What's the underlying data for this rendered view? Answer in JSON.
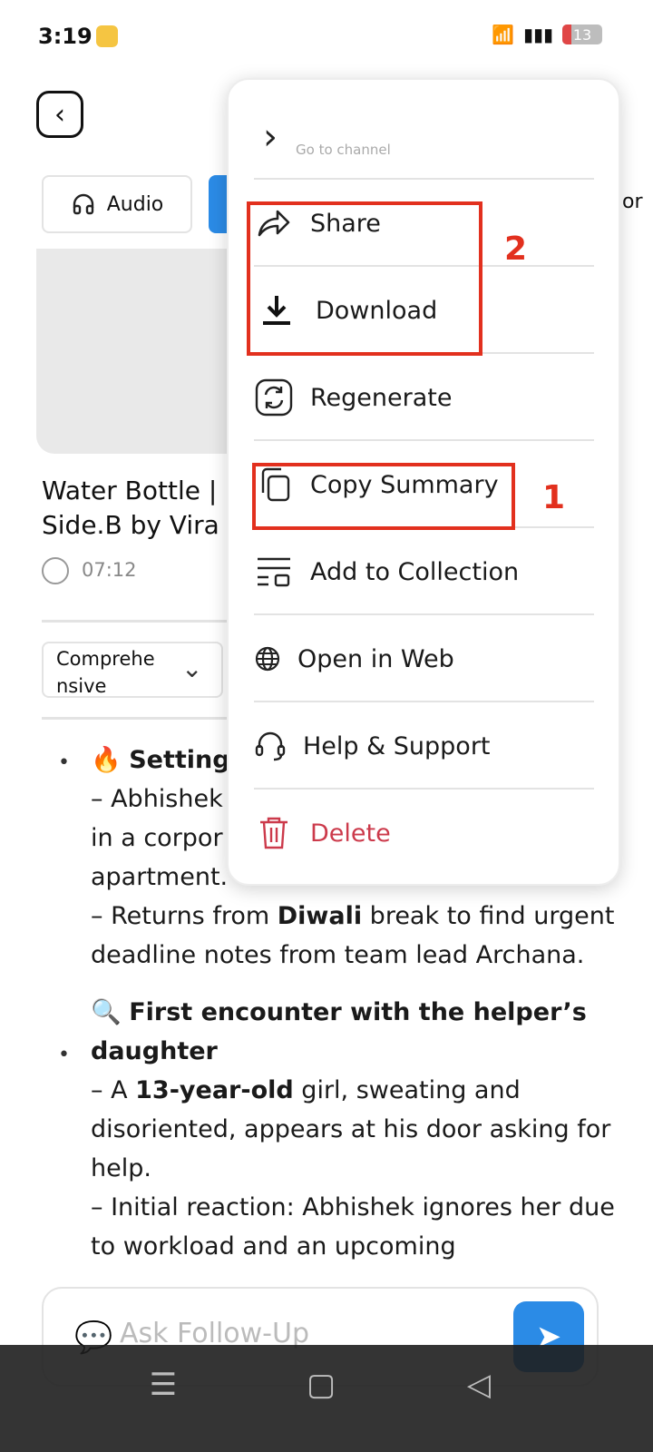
{
  "status": {
    "time": "3:19",
    "battery": "13"
  },
  "tabs": {
    "audio": "Audio",
    "edge_text": "or"
  },
  "video": {
    "title": "Water Bottle | Side.B by Vira",
    "title_line1": "Water Bottle |",
    "title_line2": "Side.B by Vira",
    "duration": "07:12"
  },
  "summary_mode": {
    "selected": "Comprehensive"
  },
  "content": {
    "p1_heading": "Setting",
    "p1_line1": "– Abhishek",
    "p1_line2": "in a corpor",
    "p1_line3": "apartment.",
    "p1_line4_a": "– Returns from ",
    "p1_line4_b": "Diwali",
    "p1_line4_c": " break to find urgent deadline notes from team lead Archana.",
    "p2_heading": "First encounter with the helper’s daughter",
    "p2_line1_a": "– A ",
    "p2_line1_b": "13-year-old",
    "p2_line1_c": " girl, sweating and disoriented, appears at his door asking for help.",
    "p2_line2": "– Initial reaction: Abhishek ignores her due to workload and an upcoming"
  },
  "ask": {
    "placeholder": "Ask Follow-Up"
  },
  "menu": {
    "go_to_channel": "Go to channel",
    "items": [
      {
        "label": "Share",
        "icon": "share-icon"
      },
      {
        "label": "Download",
        "icon": "download-icon"
      },
      {
        "label": "Regenerate",
        "icon": "refresh-icon"
      },
      {
        "label": "Copy Summary",
        "icon": "copy-icon"
      },
      {
        "label": "Add to Collection",
        "icon": "collection-icon"
      },
      {
        "label": "Open in Web",
        "icon": "globe-icon"
      },
      {
        "label": "Help & Support",
        "icon": "headset-icon"
      },
      {
        "label": "Delete",
        "icon": "trash-icon"
      }
    ]
  },
  "annotations": {
    "label_1": "1",
    "label_2": "2",
    "color": "#e2301e"
  },
  "colors": {
    "accent": "#2b8be6",
    "delete": "#cc3a4b"
  }
}
